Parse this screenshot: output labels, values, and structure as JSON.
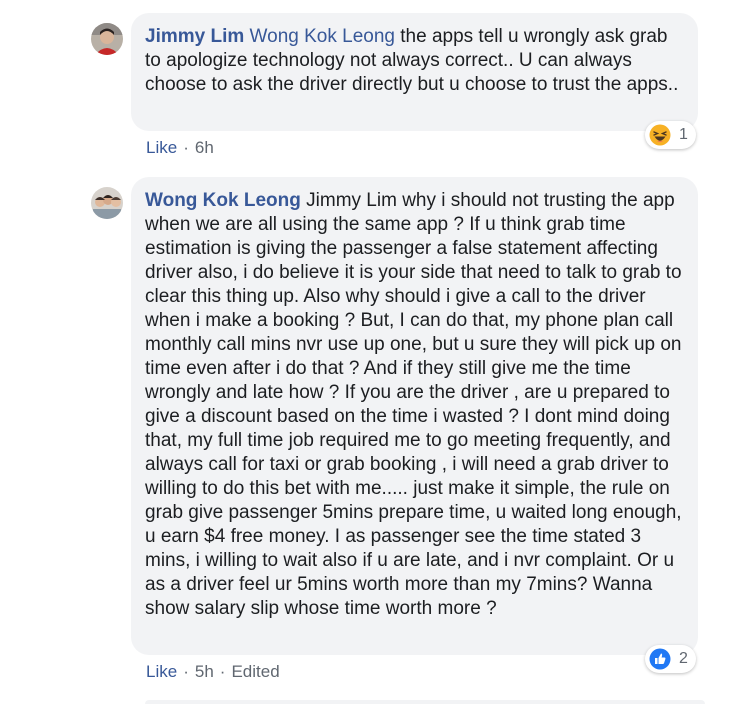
{
  "comments": [
    {
      "author": "Jimmy Lim",
      "mention": "Wong Kok Leong",
      "text": " the apps tell u wrongly ask grab to apologize technology not always correct.. U can always choose to ask the driver directly but u choose to trust the apps..",
      "like_label": "Like",
      "time": "6h",
      "edited": "",
      "reaction": {
        "icon": "haha-icon",
        "count": "1",
        "color": "#f7b125"
      }
    },
    {
      "author": "Wong Kok Leong",
      "mention": "",
      "text": "Jimmy Lim why i should not trusting the app when we are all using the same app ? If u think grab time estimation is giving the passenger a false statement affecting driver also, i do believe it is your side that need to talk to grab to clear this thing up. Also why should i give a call to the driver when i make a booking ? But, I can do that, my phone plan call monthly call mins nvr use up one, but u sure they will pick up on time even after i do that ? And if they still give me the time wrongly and late how ? If you are the driver , are u prepared to give a discount based on the time i wasted ? I dont mind doing that, my full time job required me to go meeting frequently, and always call for taxi or grab booking , i will need a grab driver to willing to do this bet with me..... just make it simple, the rule on grab give passenger 5mins prepare time, u waited long enough, u earn $4 free money. I as passenger see the time stated 3 mins, i willing to wait also if u are late, and i nvr complaint. Or u as a driver feel ur 5mins worth more than my 7mins? Wanna show salary slip whose time worth more ?",
      "like_label": "Like",
      "time": "5h",
      "edited": "Edited",
      "reaction": {
        "icon": "like-icon",
        "count": "2",
        "color": "#2078f4"
      }
    }
  ],
  "separator": "·"
}
